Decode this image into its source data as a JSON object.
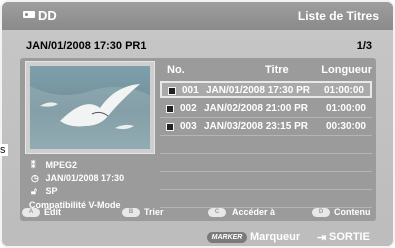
{
  "header": {
    "device_icon": "disc-drive-icon",
    "device": "DD",
    "title": "Liste de Titres"
  },
  "subheader": {
    "selected_info": "JAN/01/2008 17:30 PR1",
    "page": "1/3"
  },
  "columns": {
    "no": "No.",
    "title": "Titre",
    "length": "Longueur"
  },
  "rows": [
    {
      "no": "001",
      "title": "JAN/01/2008 17:30 PR",
      "length": "01:00:00",
      "selected": true
    },
    {
      "no": "002",
      "title": "JAN/02/2008 21:00 PR",
      "length": "01:00:00",
      "selected": false
    },
    {
      "no": "003",
      "title": "JAN/03/2008 23:15 PR",
      "length": "00:30:00",
      "selected": false
    }
  ],
  "info": {
    "format_icon": "film-icon",
    "format": "MPEG2",
    "date_icon": "clock-icon",
    "date": "JAN/01/2008 17:30",
    "quality_icon": "lock-icon",
    "quality": "SP",
    "compat": "Compatibilité V-Mode"
  },
  "color_buttons": [
    {
      "key": "A",
      "label": "Édit"
    },
    {
      "key": "B",
      "label": "Trier"
    },
    {
      "key": "C",
      "label": "Accéder à"
    },
    {
      "key": "D",
      "label": "Contenu"
    }
  ],
  "footer": {
    "marker_key": "MARKER",
    "marker_label": "Marqueur",
    "exit_icon": "exit-icon",
    "exit_label": "SORTIE"
  },
  "edge_text": "s"
}
